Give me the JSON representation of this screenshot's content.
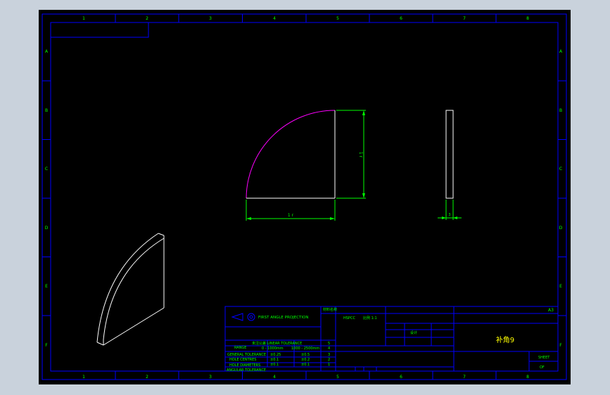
{
  "border_columns": [
    "1",
    "2",
    "3",
    "4",
    "5",
    "6",
    "7",
    "8"
  ],
  "border_rows": [
    "A",
    "B",
    "C",
    "D",
    "E",
    "F"
  ],
  "front_view": {
    "dim_horizontal": "1 r",
    "dim_vertical": "1 r"
  },
  "side_view": {
    "dim_thickness": "3"
  },
  "title_block": {
    "projection_label": "FIRST ANGLE PROJECTION",
    "material_label": "材料名称",
    "material_code": "HSPCC",
    "scale": "比例 1:1",
    "sheet_size": "A3",
    "part_name": "补角9",
    "tolerance_heading": "未注公差 LINEAR TOLERANCE",
    "range_label": "RANGE",
    "range_1": "0 - 1000mm",
    "range_2": "1000 - 2500mm",
    "row_labels": [
      "GENERAL TOLERANCE",
      "HOLE CENTRES",
      "HOLE DIAMETERS",
      "ANGULAR TOLERANCE"
    ],
    "row_values": [
      [
        "±0.25",
        "±0.5"
      ],
      [
        "±0.1",
        "±0.2"
      ],
      [
        "±0.1",
        "±0.1"
      ]
    ],
    "rev_numbers": [
      "5",
      "4",
      "3",
      "2",
      "1"
    ],
    "designed_label": "设计",
    "sheet_label": "SHEET",
    "of_label": "OF"
  },
  "colors": {
    "background": "#000000",
    "frame": "#0000ff",
    "geometry": "#ffffff",
    "dimension": "#00ff00",
    "arc": "#ff00ff",
    "text": "#00ff00",
    "text_title": "#ffff00"
  }
}
